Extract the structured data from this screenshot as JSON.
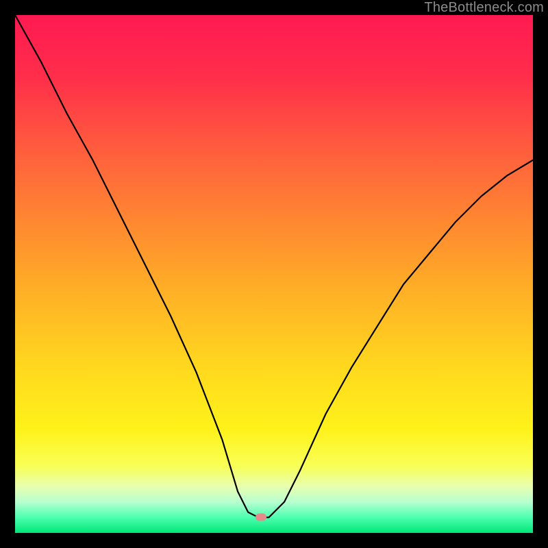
{
  "watermark": "TheBottleneck.com",
  "marker": {
    "x_pct": 47.5,
    "y_pct": 97.0
  },
  "gradient_stops": [
    {
      "pct": 0,
      "color": "#ff1a52"
    },
    {
      "pct": 12,
      "color": "#ff2e4a"
    },
    {
      "pct": 30,
      "color": "#ff6a3a"
    },
    {
      "pct": 50,
      "color": "#ffa628"
    },
    {
      "pct": 68,
      "color": "#ffd81e"
    },
    {
      "pct": 80,
      "color": "#fff21a"
    },
    {
      "pct": 87,
      "color": "#f8ff55"
    },
    {
      "pct": 91,
      "color": "#e8ffb0"
    },
    {
      "pct": 94,
      "color": "#b8ffd0"
    },
    {
      "pct": 97,
      "color": "#4dffb0"
    },
    {
      "pct": 100,
      "color": "#00e676"
    }
  ],
  "chart_data": {
    "type": "line",
    "title": "",
    "xlabel": "",
    "ylabel": "",
    "xlim": [
      0,
      100
    ],
    "ylim": [
      0,
      100
    ],
    "series": [
      {
        "name": "curve",
        "x": [
          0,
          5,
          10,
          15,
          20,
          25,
          30,
          35,
          40,
          43,
          45,
          47,
          49,
          52,
          55,
          60,
          65,
          70,
          75,
          80,
          85,
          90,
          95,
          100
        ],
        "y": [
          100,
          91,
          81,
          72,
          62,
          52,
          42,
          31,
          18,
          8,
          4,
          3,
          3,
          6,
          12,
          23,
          32,
          40,
          48,
          54,
          60,
          65,
          69,
          72
        ]
      }
    ],
    "marker_point": {
      "x": 47.5,
      "y": 3
    }
  }
}
